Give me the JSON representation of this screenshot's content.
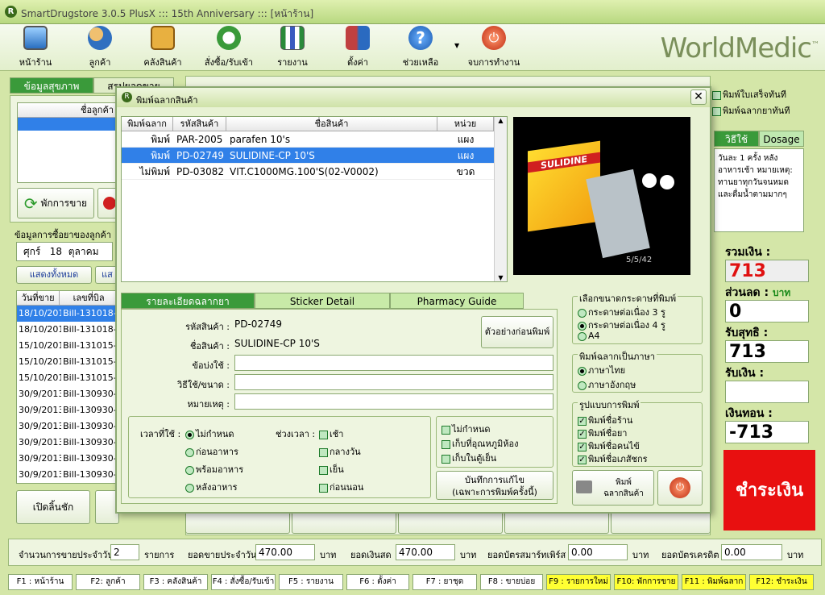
{
  "window": {
    "title": "SmartDrugstore 3.0.5 PlusX ::: 15th Anniversary ::: [หน้าร้าน]"
  },
  "toolbar": {
    "items": [
      {
        "label": "หน้าร้าน",
        "icon": "monitor-icon"
      },
      {
        "label": "ลูกค้า",
        "icon": "users-icon"
      },
      {
        "label": "คลังสินค้า",
        "icon": "inventory-search-icon"
      },
      {
        "label": "สั่งซื้อ/รับเข้า",
        "icon": "refresh-order-icon"
      },
      {
        "label": "รายงาน",
        "icon": "bar-chart-icon"
      },
      {
        "label": "ตั้งค่า",
        "icon": "tools-icon"
      },
      {
        "label": "ช่วยเหลือ",
        "icon": "help-icon"
      },
      {
        "label": "จบการทำงาน",
        "icon": "power-icon"
      }
    ],
    "logo": "WorldMedic",
    "logo_mark": "™"
  },
  "left_panel": {
    "tabs": [
      "ข้อมูลสุขภาพ",
      "สรุปยอดขาย"
    ],
    "customer_header": "ชื่อลูกค้า",
    "pause_sale_button": "พักการขาย",
    "purchase_info_label": "ข้อมูลการซื้อยาของลูกค้า",
    "date_day": "ศุกร์",
    "date_num": "18",
    "date_month": "ตุลาคม",
    "show_all_button": "แสดงทั้งหมด",
    "show_button": "แส",
    "bills_header": {
      "date": "วันที่ขาย",
      "bill": "เลขที่บิล"
    },
    "bills": [
      {
        "date": "18/10/2013",
        "bill": "Bill-131018-0"
      },
      {
        "date": "18/10/2013",
        "bill": "Bill-131018-0"
      },
      {
        "date": "15/10/2013",
        "bill": "Bill-131015-0"
      },
      {
        "date": "15/10/2013",
        "bill": "Bill-131015-0"
      },
      {
        "date": "15/10/2013",
        "bill": "Bill-131015-0"
      },
      {
        "date": "30/9/2013",
        "bill": "Bill-130930-0"
      },
      {
        "date": "30/9/2013",
        "bill": "Bill-130930-0"
      },
      {
        "date": "30/9/2013",
        "bill": "Bill-130930-0"
      },
      {
        "date": "30/9/2013",
        "bill": "Bill-130930-0"
      },
      {
        "date": "30/9/2013",
        "bill": "Bill-130930-0"
      },
      {
        "date": "30/9/2013",
        "bill": "Bill-130930-0"
      }
    ],
    "open_drawer_button": "เปิดลิ้นชัก"
  },
  "right_panel": {
    "print_receipt_now": "พิมพ์ใบเสร็จทันที",
    "print_label_now": "พิมพ์ฉลากยาทันที",
    "tab_usage": "วิธีใช้",
    "tab_dosage": "Dosage",
    "usage_text": "วันละ 1 ครั้ง หลังอาหารเช้า หมายเหตุ: ทานยาทุกวันจนหมด และดื่มน้ำตามมากๆ",
    "total_label": "รวมเงิน :",
    "total_value": "713",
    "discount_label": "ส่วนลด :",
    "discount_unit": "บาท",
    "discount_value": "0",
    "net_label": "รับสุทธิ :",
    "net_value": "713",
    "received_label": "รับเงิน :",
    "received_value": "",
    "change_label": "เงินทอน :",
    "change_value": "-713",
    "pay_button": "ชำระเงิน"
  },
  "dialog": {
    "title": "พิมพ์ฉลากสินค้า",
    "grid_headers": [
      "พิมพ์ฉลาก",
      "รหัสสินค้า",
      "ชื่อสินค้า",
      "หน่วย"
    ],
    "rows": [
      {
        "print": "พิมพ์",
        "code": "PAR-2005",
        "name": "parafen 10's",
        "unit": "แผง"
      },
      {
        "print": "พิมพ์",
        "code": "PD-02749",
        "name": "SULIDINE-CP 10'S",
        "unit": "แผง"
      },
      {
        "print": "ไม่พิมพ์",
        "code": "PD-03082",
        "name": "VIT.C1000MG.100'S(02-V0002)",
        "unit": "ขวด"
      }
    ],
    "product_image": {
      "brand_text": "SULIDINE",
      "caption": "5/5/42"
    },
    "tabs": [
      "รายละเอียดฉลากยา",
      "Sticker Detail",
      "Pharmacy Guide"
    ],
    "detail": {
      "code_label": "รหัสสินค้า :",
      "code_value": "PD-02749",
      "name_label": "ชื่อสินค้า :",
      "name_value": "SULIDINE-CP 10'S",
      "indication_label": "ข้อบ่งใช้ :",
      "usage_label": "วิธีใช้/ขนาด :",
      "note_label": "หมายเหตุ :",
      "preview_button": "ตัวอย่างก่อนพิมพ์"
    },
    "time_label": "เวลาที่ใช้ :",
    "time_options": [
      "ไม่กำหนด",
      "ก่อนอาหาร",
      "พร้อมอาหาร",
      "หลังอาหาร"
    ],
    "period_label": "ช่วงเวลา :",
    "period_options": [
      "เช้า",
      "กลางวัน",
      "เย็น",
      "ก่อนนอน"
    ],
    "storage_options": [
      "ไม่กำหนด",
      "เก็บที่อุณหภูมิห้อง",
      "เก็บในตู้เย็น"
    ],
    "save_button_line1": "บันทึกการแก้ไข",
    "save_button_line2": "(เฉพาะการพิมพ์ครั้งนี้)",
    "paper_group_title": "เลือกขนาดกระดาษที่พิมพ์",
    "paper_options": [
      "กระดาษต่อเนื่อง 3 รู",
      "กระดาษต่อเนื่อง 4 รู",
      "A4"
    ],
    "language_group_title": "พิมพ์ฉลากเป็นภาษา",
    "language_options": [
      "ภาษาไทย",
      "ภาษาอังกฤษ"
    ],
    "format_group_title": "รูปแบบการพิมพ์",
    "format_options": [
      "พิมพ์ชื่อร้าน",
      "พิมพ์ชื่อยา",
      "พิมพ์ชื่อคนไข้",
      "พิมพ์ชื่อเภสัชกร"
    ],
    "print_button_line1": "พิมพ์",
    "print_button_line2": "ฉลากสินค้า"
  },
  "status": {
    "daily_count_label": "จำนวนการขายประจำวัน",
    "daily_count_value": "2",
    "daily_count_unit": "รายการ",
    "daily_sales_label": "ยอดขายประจำวัน",
    "daily_sales_value": "470.00",
    "daily_sales_unit": "บาท",
    "cash_label": "ยอดเงินสด",
    "cash_value": "470.00",
    "cash_unit": "บาท",
    "smartpurse_label": "ยอดบัตรสมาร์ทเพิร์ส",
    "smartpurse_value": "0.00",
    "smartpurse_unit": "บาท",
    "credit_label": "ยอดบัตรเครดิต",
    "credit_value": "0.00",
    "credit_unit": "บาท"
  },
  "fkeys": [
    "F1 : หน้าร้าน",
    "F2: ลูกค้า",
    "F3 : คลังสินค้า",
    "F4 : สั่งซื้อ/รับเข้า",
    "F5 : รายงาน",
    "F6 : ตั้งค่า",
    "F7 : ยาชุด",
    "F8 : ขายบ่อย",
    "F9 : รายการใหม่",
    "F10: พักการขาย",
    "F11 : พิมพ์ฉลาก",
    "F12: ชำระเงิน"
  ]
}
